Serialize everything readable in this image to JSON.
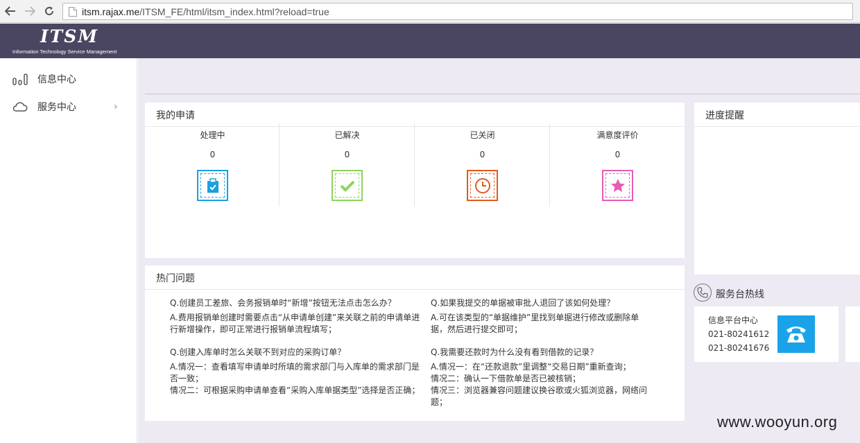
{
  "browser": {
    "url_host": "itsm.rajax.me",
    "url_path": "/ITSM_FE/html/itsm_index.html?reload=true"
  },
  "header": {
    "logo_text": "ITSM",
    "logo_subtitle": "Information Technology Service Management",
    "background_color": "#4a4560"
  },
  "sidebar": {
    "items": [
      {
        "label": "信息中心",
        "icon": "bar-chart-icon"
      },
      {
        "label": "服务中心",
        "icon": "cloud-icon",
        "arrow": "›"
      }
    ]
  },
  "my_requests": {
    "title": "我的申请",
    "stats": [
      {
        "label": "处理中",
        "count": "0",
        "icon": "clipboard-icon",
        "color": "#19a0e0"
      },
      {
        "label": "已解决",
        "count": "0",
        "icon": "check-icon",
        "color": "#8ed45a"
      },
      {
        "label": "已关闭",
        "count": "0",
        "icon": "clock-icon",
        "color": "#e4591e"
      },
      {
        "label": "满意度评价",
        "count": "0",
        "icon": "star-icon",
        "color": "#e55cb3"
      }
    ]
  },
  "progress_reminder": {
    "title": "进度提醒"
  },
  "hot_questions": {
    "title": "热门问题",
    "items": [
      {
        "q": "Q.创建员工差旅、会务报销单时“新增”按钮无法点击怎么办？",
        "a": [
          "A.费用报销单创建时需要点击“从申请单创建”来关联之前的申请单进行新增操作，即可正常进行报销单流程填写；"
        ]
      },
      {
        "q": "Q.如果我提交的单据被审批人退回了该如何处理？",
        "a": [
          "A.可在该类型的“单据维护”里找到单据进行修改或删除单据，然后进行提交即可；"
        ]
      },
      {
        "q": "Q.创建入库单时怎么关联不到对应的采购订单？",
        "a": [
          "A.情况一：查看填写申请单时所填的需求部门与入库单的需求部门是否一致；",
          "情况二：可根据采购申请单查看“采购入库单据类型”选择是否正确；"
        ]
      },
      {
        "q": "Q.我需要还款时为什么没有看到借款的记录？",
        "a": [
          "A.情况一：在“还款退款”里调整“交易日期”重新查询；",
          "情况二：确认一下借款单是否已被核销；",
          "情况三：浏览器兼容问题建议换谷歌或火狐浏览器，网络问题；"
        ]
      }
    ]
  },
  "hotline": {
    "title": "服务台热线",
    "center_name": "信息平台中心",
    "phone1": "021-80241612",
    "phone2": "021-80241676"
  },
  "watermark": "www.wooyun.org"
}
